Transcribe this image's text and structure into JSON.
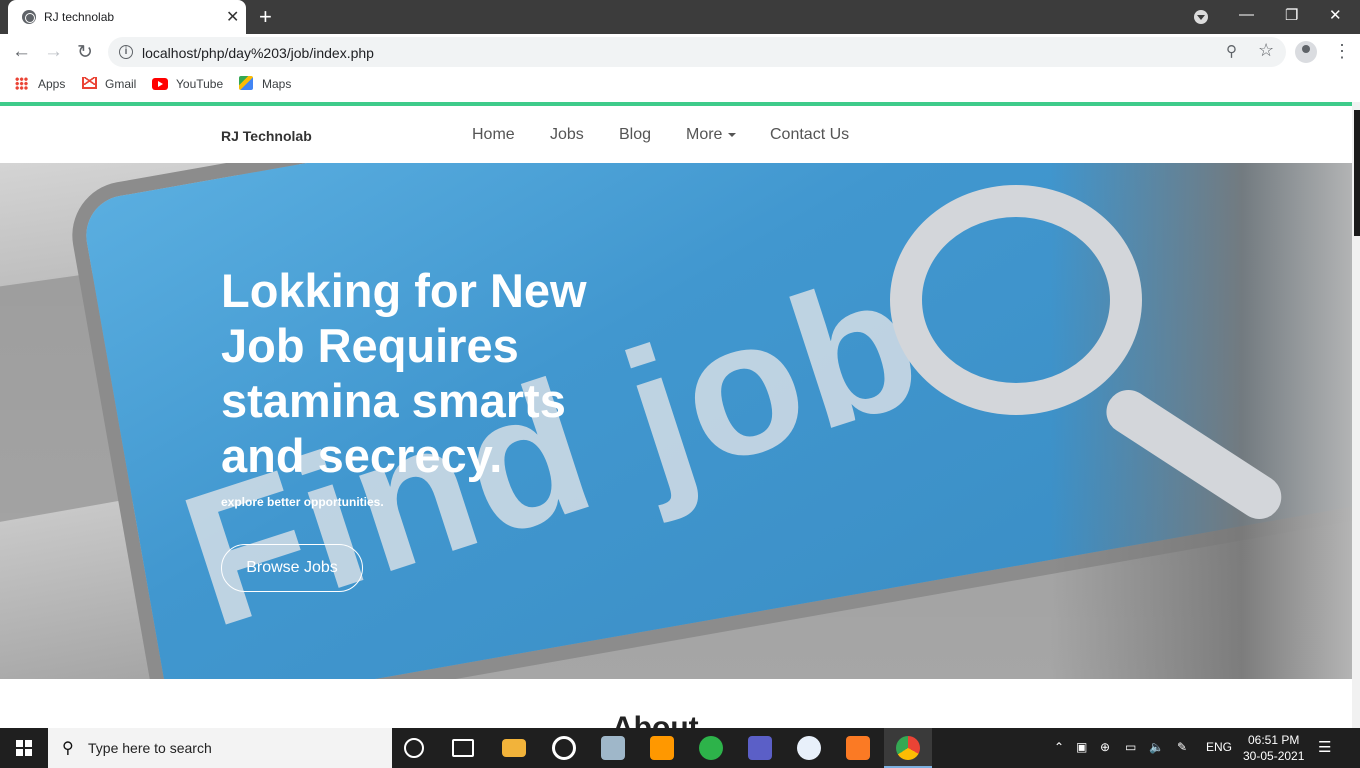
{
  "browser": {
    "tab_title": "RJ technolab",
    "url": "localhost/php/day%203/job/index.php",
    "bookmarks": [
      "Apps",
      "Gmail",
      "YouTube",
      "Maps"
    ]
  },
  "site": {
    "brand": "RJ Technolab",
    "menu": [
      "Home",
      "Jobs",
      "Blog",
      "More",
      "Contact Us"
    ],
    "hero": {
      "image_text": "Find job",
      "title": "Lokking for New Job Requires stamina smarts and secrecy.",
      "subtitle": "explore better opportunities.",
      "button": "Browse Jobs"
    },
    "next_section_peek": "About"
  },
  "taskbar": {
    "search_placeholder": "Type here to search",
    "language": "ENG",
    "time": "06:51 PM",
    "date": "30-05-2021"
  },
  "colors": {
    "accent_green": "#3ecb8a",
    "key_blue": "#4197cf",
    "chrome_dark": "#3c3c3c"
  }
}
